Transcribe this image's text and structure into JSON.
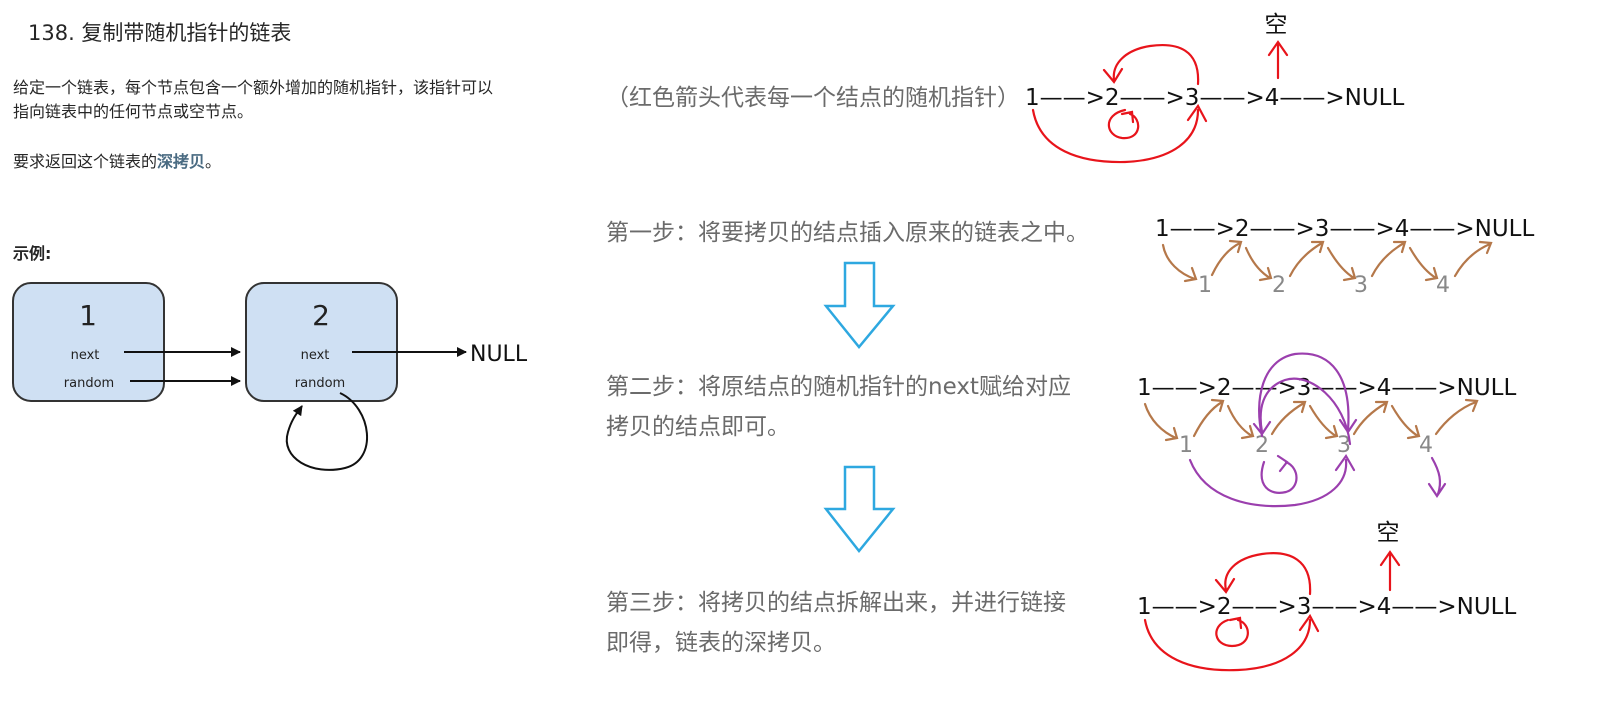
{
  "problem": {
    "title": "138. 复制带随机指针的链表",
    "desc_line1": "给定一个链表，每个节点包含一个额外增加的随机指针，该指针可以",
    "desc_line2": "指向链表中的任何节点或空节点。",
    "desc2_prefix": "要求返回这个链表的",
    "desc2_bold": "深拷贝",
    "desc2_suffix": "。",
    "example_label": "示例:"
  },
  "example_diagram": {
    "node1_value": "1",
    "node2_value": "2",
    "next_label": "next",
    "random_label": "random",
    "null_label": "NULL"
  },
  "explanation": {
    "red_note": "（红色箭头代表每一个结点的随机指针）",
    "step1": "第一步：将要拷贝的结点插入原来的链表之中。",
    "step2_line1": "第二步：将原结点的随机指针的next赋给对应",
    "step2_line2": "拷贝的结点即可。",
    "step3_line1": "第三步：将拷贝的结点拆解出来，并进行链接",
    "step3_line2": "即得，链表的深拷贝。"
  },
  "sketches": {
    "original_chain": "1——>2——>3——>4——>NULL",
    "empty_label": "空",
    "step1_chain": "1——>2——>3——>4——>NULL",
    "step2_chain": "1——>2——>3——>4——>NULL",
    "result_chain": "1——>2——>3——>4——>NULL",
    "copy_nodes": [
      "1",
      "2",
      "3",
      "4"
    ]
  },
  "colors": {
    "random_pointer": "#e8141b",
    "copy_link": "#b5784a",
    "copy_random": "#9b3fae",
    "down_arrow": "#2ea8e0",
    "node_fill": "#cfe0f3"
  }
}
